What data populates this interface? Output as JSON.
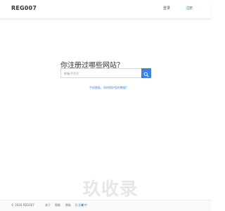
{
  "header": {
    "brand": "REG007",
    "login_label": "登录",
    "register_label": "注册"
  },
  "main": {
    "headline": "你注册过哪些网站？",
    "search": {
      "placeholder": "邮箱/手机号",
      "value": ""
    },
    "help_link": "手机隐私，如何保护您的数据？"
  },
  "footer": {
    "copyright": "© 2024 REG007",
    "about": "关于",
    "help": "帮助",
    "privacy": "隐私",
    "qq_label": "Q 反馈",
    "lang_label": "♦ 中"
  },
  "watermark": "玖收录",
  "colors": {
    "accent": "#3f7fe0",
    "register": "#1aa34a"
  }
}
